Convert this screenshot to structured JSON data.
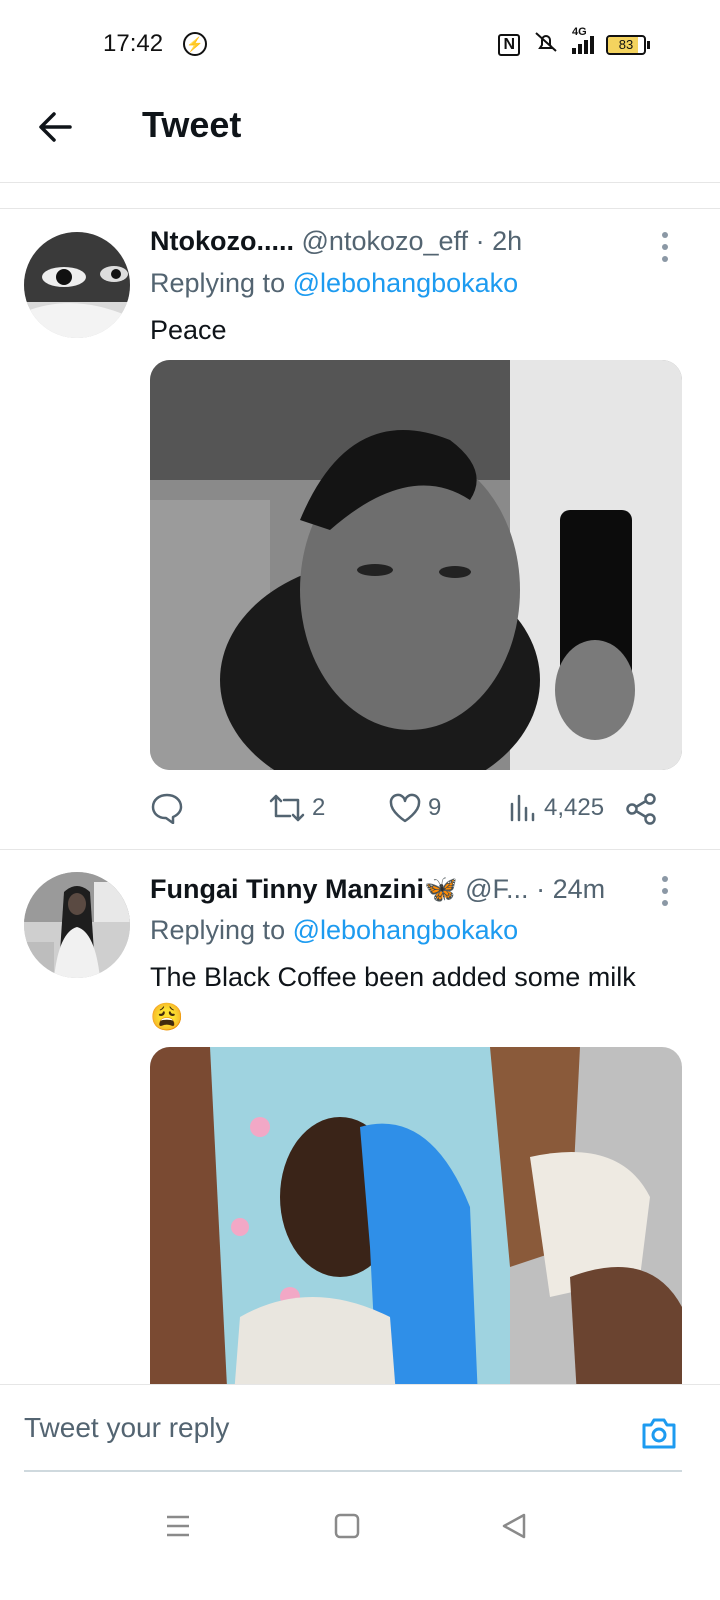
{
  "status_bar": {
    "time": "17:42",
    "network": "4G",
    "battery": 83,
    "battery_text": "83"
  },
  "header": {
    "title": "Tweet"
  },
  "tweets": [
    {
      "name": "Ntokozo.....",
      "handle": "@ntokozo_eff",
      "sep": "·",
      "time": "2h",
      "replying_prefix": "Replying to",
      "replying_to": "@lebohangbokako",
      "text": "Peace",
      "retweets": "2",
      "likes": "9",
      "views": "4,425"
    },
    {
      "name": "Fungai Tinny Manzini🦋",
      "handle": "@F...",
      "sep": "·",
      "time": "24m",
      "replying_prefix": "Replying to",
      "replying_to": "@lebohangbokako",
      "text": "The Black Coffee been added some milk",
      "emoji": "😩"
    }
  ],
  "reply": {
    "placeholder": "Tweet your reply"
  },
  "colors": {
    "accent": "#1d9bf0",
    "secondary_text": "#536471"
  }
}
